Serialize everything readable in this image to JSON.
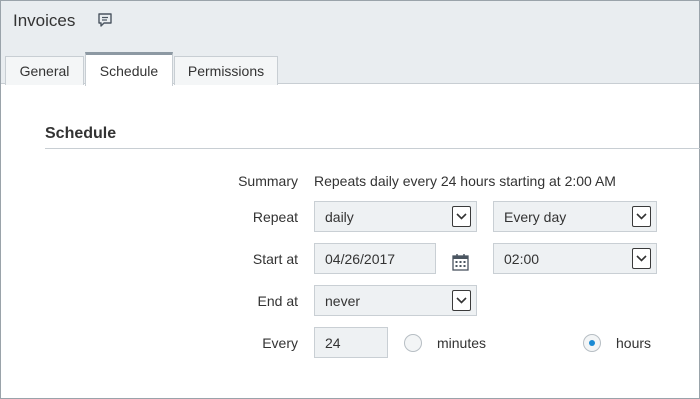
{
  "window": {
    "title": "Invoices",
    "comment_icon": "comment-icon"
  },
  "tabs": [
    {
      "label": "General",
      "active": false
    },
    {
      "label": "Schedule",
      "active": true
    },
    {
      "label": "Permissions",
      "active": false
    }
  ],
  "section": {
    "title": "Schedule"
  },
  "form": {
    "summary": {
      "label": "Summary",
      "value": "Repeats daily every 24 hours starting at 2:00 AM"
    },
    "repeat": {
      "label": "Repeat",
      "frequency": "daily",
      "interval": "Every day"
    },
    "start_at": {
      "label": "Start at",
      "date": "04/26/2017",
      "time": "02:00",
      "calendar_icon": "calendar-icon"
    },
    "end_at": {
      "label": "End at",
      "value": "never"
    },
    "every": {
      "label": "Every",
      "value": "24",
      "units": [
        {
          "label": "minutes",
          "selected": false
        },
        {
          "label": "hours",
          "selected": true
        }
      ]
    }
  },
  "colors": {
    "header_bg": "#e9edf0",
    "field_bg": "#eef1f3",
    "radio_accent": "#1a8ad4"
  }
}
